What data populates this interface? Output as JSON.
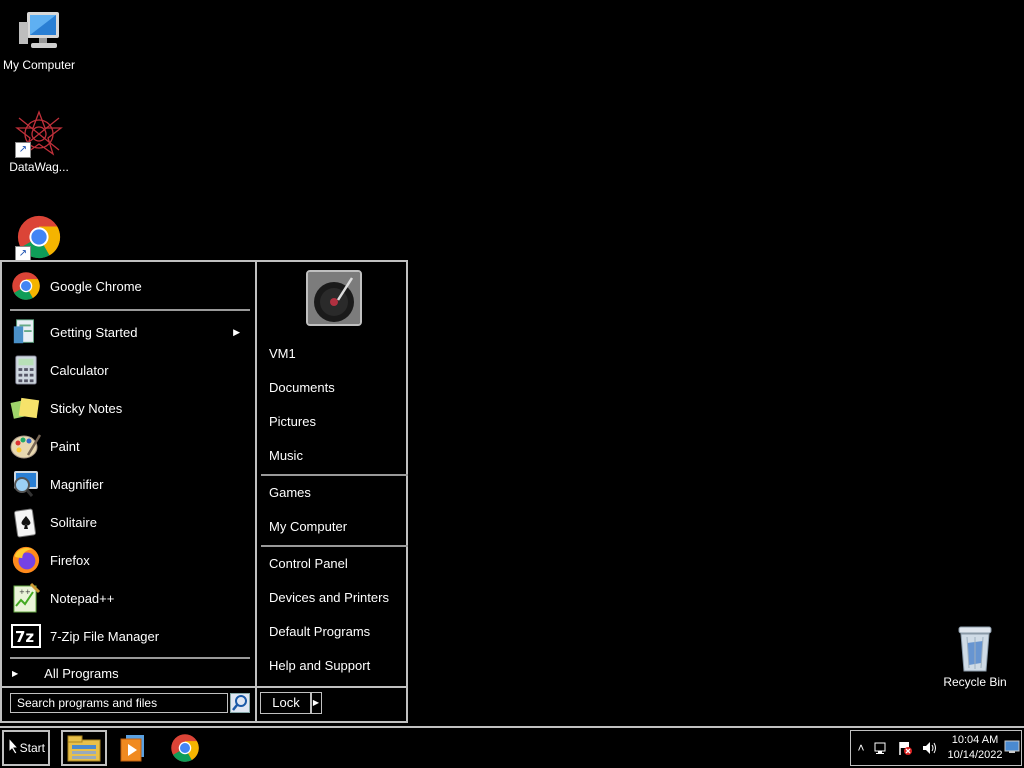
{
  "desktop": {
    "icons": [
      {
        "label": "My Computer",
        "icon": "computer-icon"
      },
      {
        "label": "DataWag...",
        "icon": "datawag-icon"
      },
      {
        "label": "",
        "icon": "chrome-icon"
      },
      {
        "label": "Recycle Bin",
        "icon": "recycle-bin-icon"
      }
    ]
  },
  "start_menu": {
    "pinned": {
      "label": "Google Chrome",
      "icon": "chrome-icon"
    },
    "programs": [
      {
        "label": "Getting Started",
        "icon": "getting-started-icon",
        "has_submenu": true
      },
      {
        "label": "Calculator",
        "icon": "calculator-icon"
      },
      {
        "label": "Sticky Notes",
        "icon": "sticky-notes-icon"
      },
      {
        "label": "Paint",
        "icon": "paint-icon"
      },
      {
        "label": "Magnifier",
        "icon": "magnifier-icon"
      },
      {
        "label": "Solitaire",
        "icon": "solitaire-icon"
      },
      {
        "label": "Firefox",
        "icon": "firefox-icon"
      },
      {
        "label": "Notepad++",
        "icon": "notepadpp-icon"
      },
      {
        "label": "7-Zip File Manager",
        "icon": "7zip-icon"
      }
    ],
    "all_programs": "All Programs",
    "search_placeholder": "Search programs and files",
    "places": [
      "VM1",
      "Documents",
      "Pictures",
      "Music",
      "Games",
      "My Computer",
      "Control Panel",
      "Devices and Printers",
      "Default Programs",
      "Help and Support"
    ],
    "lock_label": "Lock"
  },
  "taskbar": {
    "start_label": "Start",
    "pinned": [
      {
        "icon": "file-explorer-icon"
      },
      {
        "icon": "media-player-icon"
      },
      {
        "icon": "chrome-icon"
      }
    ],
    "clock": {
      "time": "10:04 AM",
      "date": "10/14/2022"
    }
  },
  "colors": {
    "background": "#000000",
    "border": "#c0c0c0",
    "text": "#ffffff"
  }
}
